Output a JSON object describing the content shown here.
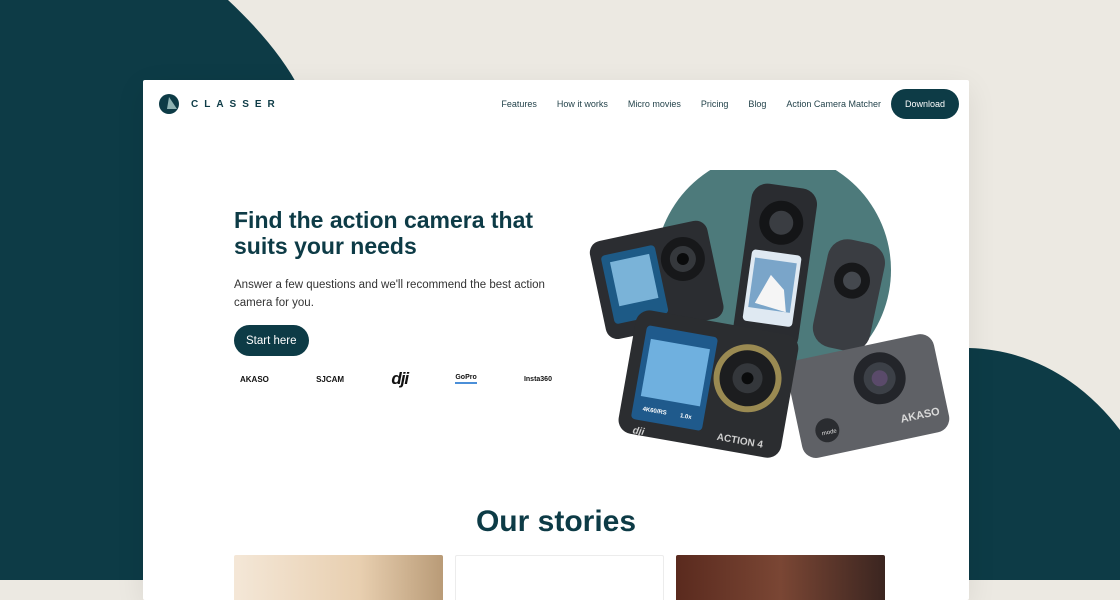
{
  "brand": {
    "name": "CLASSER"
  },
  "nav": {
    "items": [
      "Features",
      "How it works",
      "Micro movies",
      "Pricing",
      "Blog",
      "Action Camera Matcher"
    ],
    "download_label": "Download"
  },
  "hero": {
    "title": "Find the action camera that suits your needs",
    "subtitle": "Answer a few questions and we'll recommend the best action camera for you.",
    "cta_label": "Start here"
  },
  "partner_logos": [
    "AKASO",
    "SJCAM",
    "dji",
    "GoPro",
    "Insta360"
  ],
  "cameras": {
    "dji_labels": [
      "dji",
      "ACTION 4",
      "4K60/RS",
      "1.0x"
    ],
    "akaso_labels": [
      "AKASO",
      "mode"
    ]
  },
  "stories": {
    "title": "Our stories"
  },
  "colors": {
    "primary": "#0d3b46",
    "circle": "#4d7a7b",
    "page_bg": "#ece9e2"
  }
}
